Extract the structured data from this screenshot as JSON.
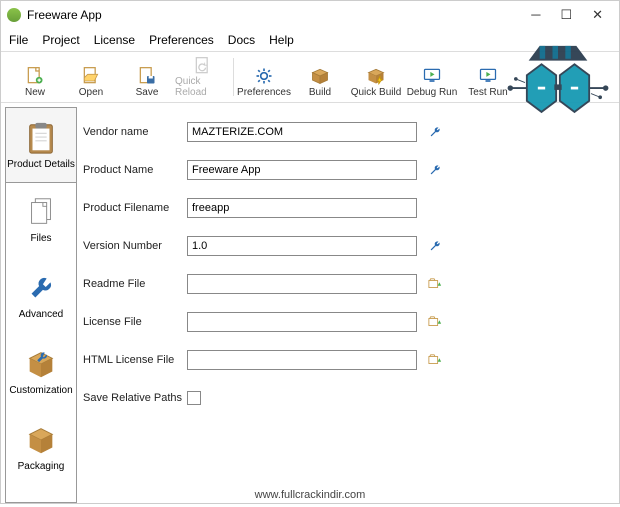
{
  "window": {
    "title": "Freeware App"
  },
  "menu": [
    "File",
    "Project",
    "License",
    "Preferences",
    "Docs",
    "Help"
  ],
  "toolbar": [
    {
      "label": "New",
      "icon": "file-new"
    },
    {
      "label": "Open",
      "icon": "file-open"
    },
    {
      "label": "Save",
      "icon": "file-save"
    },
    {
      "label": "Quick Reload",
      "icon": "reload",
      "disabled": true
    },
    {
      "divider": true
    },
    {
      "label": "Preferences",
      "icon": "gear"
    },
    {
      "label": "Build",
      "icon": "box"
    },
    {
      "label": "Quick Build",
      "icon": "box-lightning"
    },
    {
      "label": "Debug Run",
      "icon": "screen-play"
    },
    {
      "label": "Test Run",
      "icon": "screen-play"
    }
  ],
  "sidetabs": [
    {
      "label": "Product Details",
      "icon": "clipboard",
      "selected": true
    },
    {
      "label": "Files",
      "icon": "files"
    },
    {
      "label": "Advanced",
      "icon": "wrench-big"
    },
    {
      "label": "Customization",
      "icon": "box-wrench"
    },
    {
      "label": "Packaging",
      "icon": "box-plain"
    }
  ],
  "form": {
    "vendor_label": "Vendor name",
    "vendor_value": "MAZTERIZE.COM",
    "product_label": "Product Name",
    "product_value": "Freeware App",
    "filename_label": "Product Filename",
    "filename_value": "freeapp",
    "version_label": "Version Number",
    "version_value": "1.0",
    "readme_label": "Readme File",
    "readme_value": "",
    "license_label": "License File",
    "license_value": "",
    "html_license_label": "HTML License File",
    "html_license_value": "",
    "relpaths_label": "Save Relative Paths"
  },
  "footer": "www.fullcrackindir.com"
}
